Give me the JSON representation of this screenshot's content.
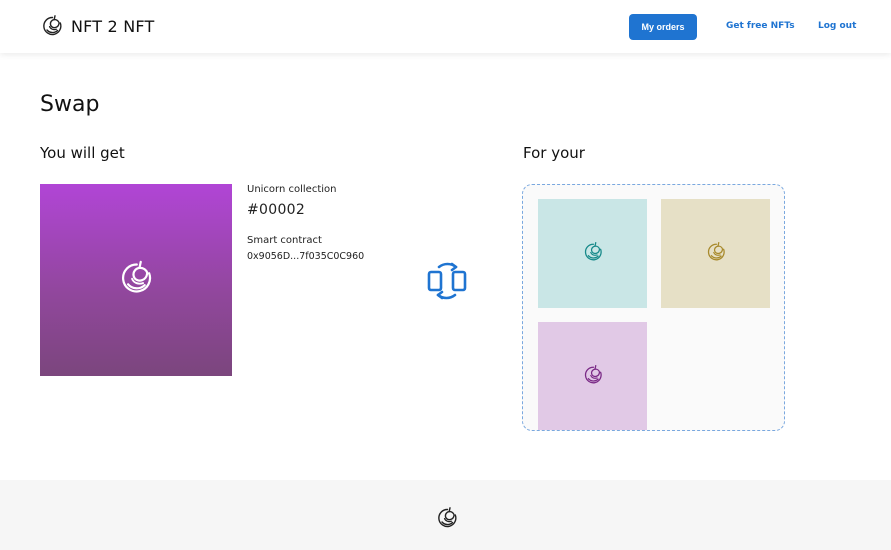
{
  "header": {
    "brand": "NFT 2 NFT",
    "nav": {
      "my_orders": "My orders",
      "get_free": "Get free NFTs",
      "logout": "Log out"
    }
  },
  "page": {
    "title": "Swap",
    "you_will_get": "You will get",
    "for_your": "For your"
  },
  "nft": {
    "collection": "Unicorn collection",
    "id": "#00002",
    "contract_label": "Smart contract",
    "contract": "0x9056D...7f035C0C960"
  },
  "colors": {
    "accent": "#1f74d1",
    "tile_teal": "#c9e6e6",
    "tile_beige": "#e6e0c6",
    "tile_lilac": "#e1c9e6",
    "icon_teal": "#178a8a",
    "icon_gold": "#a88a2c",
    "icon_purple": "#7a2a86"
  },
  "icons": {
    "logo": "unicorn-logo-icon",
    "swap": "swap-arrows-icon"
  }
}
